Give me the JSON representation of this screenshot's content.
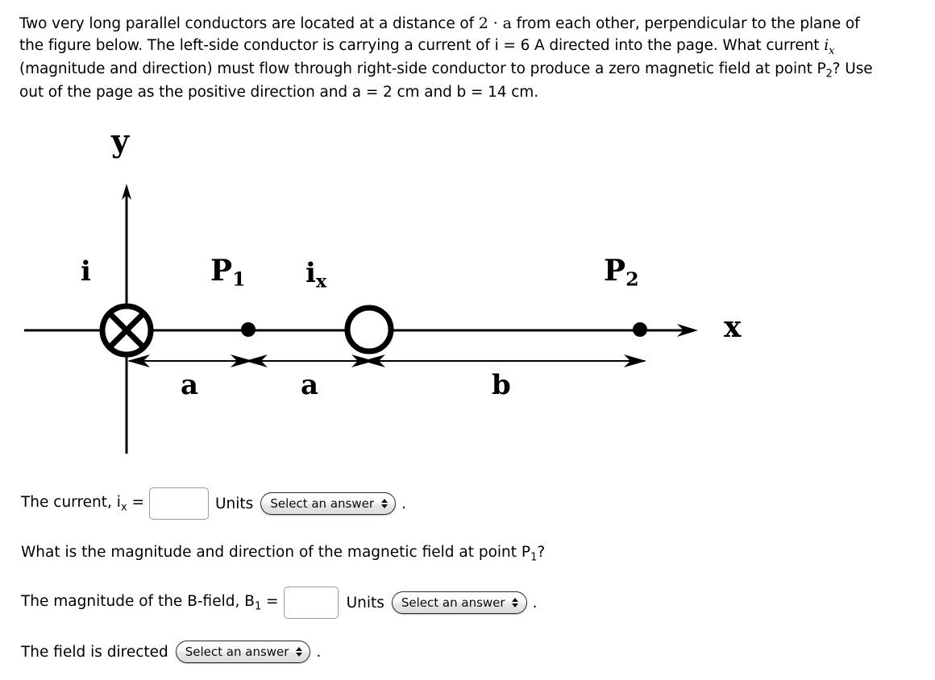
{
  "problem": {
    "line1_a": "Two very long parallel conductors are located at a distance of ",
    "math_2a": "2 · a",
    "line1_b": " from each other, perpendicular to the plane of the figure below. The left-side conductor is carrying a current of i = 6 A directed into the page. What current ",
    "math_ix": "i",
    "math_ix_sub": "x",
    "line1_c": " (magnitude and direction) must flow through right-side conductor to produce a zero magnetic field at point P",
    "p2_sub": "2",
    "line1_d": "? Use out of the page as the positive direction and a = 2 cm and b = 14 cm.",
    "current_value": "6 A",
    "a_value": "2 cm",
    "b_value": "14 cm"
  },
  "figure": {
    "y_axis_label": "y",
    "x_axis_label": "x",
    "current_in_label": "i",
    "current_x_label": "i",
    "current_x_sub": "x",
    "point1_label": "P",
    "point1_sub": "1",
    "point2_label": "P",
    "point2_sub": "2",
    "dim_a_left": "a",
    "dim_a_right": "a",
    "dim_b": "b",
    "stroke_color": "#000000"
  },
  "answers": {
    "q1": {
      "label_pre": "The current, i",
      "label_sub": "x",
      "label_post": " =",
      "input_value": "",
      "units_label": "Units",
      "select_value": "Select an answer",
      "trailing": "."
    },
    "q2_prompt_pre": "What is the magnitude and direction of the magnetic field at point P",
    "q2_prompt_sub": "1",
    "q2_prompt_post": "?",
    "q2": {
      "label_pre": "The magnitude of the B-field, B",
      "label_sub": "1",
      "label_post": " =",
      "input_value": "",
      "units_label": "Units",
      "select_value": "Select an answer",
      "trailing": "."
    },
    "q3": {
      "label": "The field is directed",
      "select_value": "Select an answer",
      "trailing": "."
    }
  }
}
